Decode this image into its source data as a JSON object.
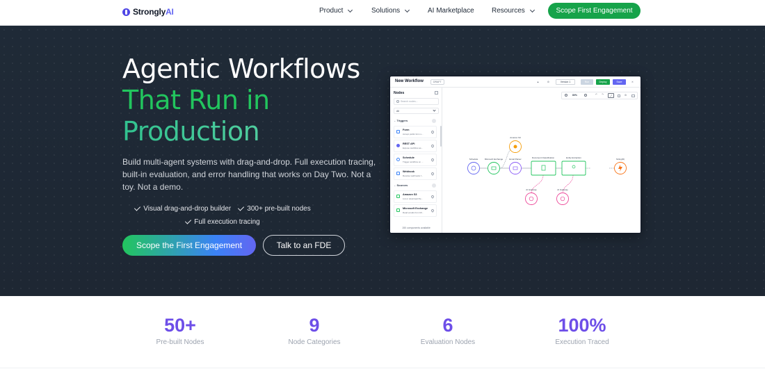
{
  "nav": {
    "logo_main": "Strongly",
    "logo_ai": "AI",
    "links": [
      {
        "label": "Product",
        "dropdown": true
      },
      {
        "label": "Solutions",
        "dropdown": true
      },
      {
        "label": "AI Marketplace",
        "dropdown": false
      },
      {
        "label": "Resources",
        "dropdown": true
      }
    ],
    "cta": "Scope First Engagement"
  },
  "hero": {
    "title_line1": "Agentic Workflows",
    "title_line2": "That Run in",
    "title_line3": "Production",
    "description": "Build multi-agent systems with drag-and-drop. Full execution tracing, built-in evaluation, and error handling that works on Day Two. Not a toy. Not a demo.",
    "features": [
      "Visual drag-and-drop builder",
      "300+ pre-built nodes",
      "Full execution tracing"
    ],
    "primary_button": "Scope the First Engagement",
    "secondary_button": "Talk to an FDE"
  },
  "preview": {
    "title": "New Workflow",
    "status": "DRAFT",
    "toolbar": {
      "version": "Version 1",
      "run": "Run",
      "deploy": "Deploy",
      "save": "Save"
    },
    "sidebar": {
      "title": "Nodes",
      "search_placeholder": "Search nodes...",
      "filter": "All",
      "groups": [
        {
          "label": "Triggers",
          "nodes": [
            {
              "name": "Form",
              "desc": "Accept public form s..."
            },
            {
              "name": "REST API",
              "desc": "Expose workflow as..."
            },
            {
              "name": "Schedule",
              "desc": "Trigger workflow on ..."
            },
            {
              "name": "Webhook",
              "desc": "Receive webhooks f..."
            }
          ]
        },
        {
          "label": "Sources",
          "nodes": [
            {
              "name": "Amazon S3",
              "desc": "List or download file..."
            },
            {
              "name": "Microsoft Exchange",
              "desc": "Read emails from Mi..."
            }
          ]
        }
      ],
      "footer": "150 components available"
    },
    "zoom": "80%",
    "flow_nodes": [
      {
        "label": "Schedule",
        "color": "#6366f1"
      },
      {
        "label": "Microsoft Exchange",
        "color": "#22c55e"
      },
      {
        "label": "Email Parser",
        "color": "#8b5cf6"
      },
      {
        "label": "Amazon S3",
        "color": "#f59e0b"
      },
      {
        "label": "Document Classification",
        "color": "#22c55e"
      },
      {
        "label": "Entity Extraction",
        "color": "#22c55e"
      },
      {
        "label": "String(D)",
        "color": "#f97316"
      },
      {
        "label": "AI Gateway",
        "color": "#ec4899"
      },
      {
        "label": "AI Gateway",
        "color": "#ec4899"
      }
    ]
  },
  "stats": [
    {
      "value": "50+",
      "label": "Pre-built Nodes"
    },
    {
      "value": "9",
      "label": "Node Categories"
    },
    {
      "value": "6",
      "label": "Evaluation Nodes"
    },
    {
      "value": "100%",
      "label": "Execution Traced"
    }
  ],
  "colors": {
    "accent_green": "#16a34a",
    "stat_purple": "#6d4ee8",
    "hero_bg": "#1f2a37"
  }
}
